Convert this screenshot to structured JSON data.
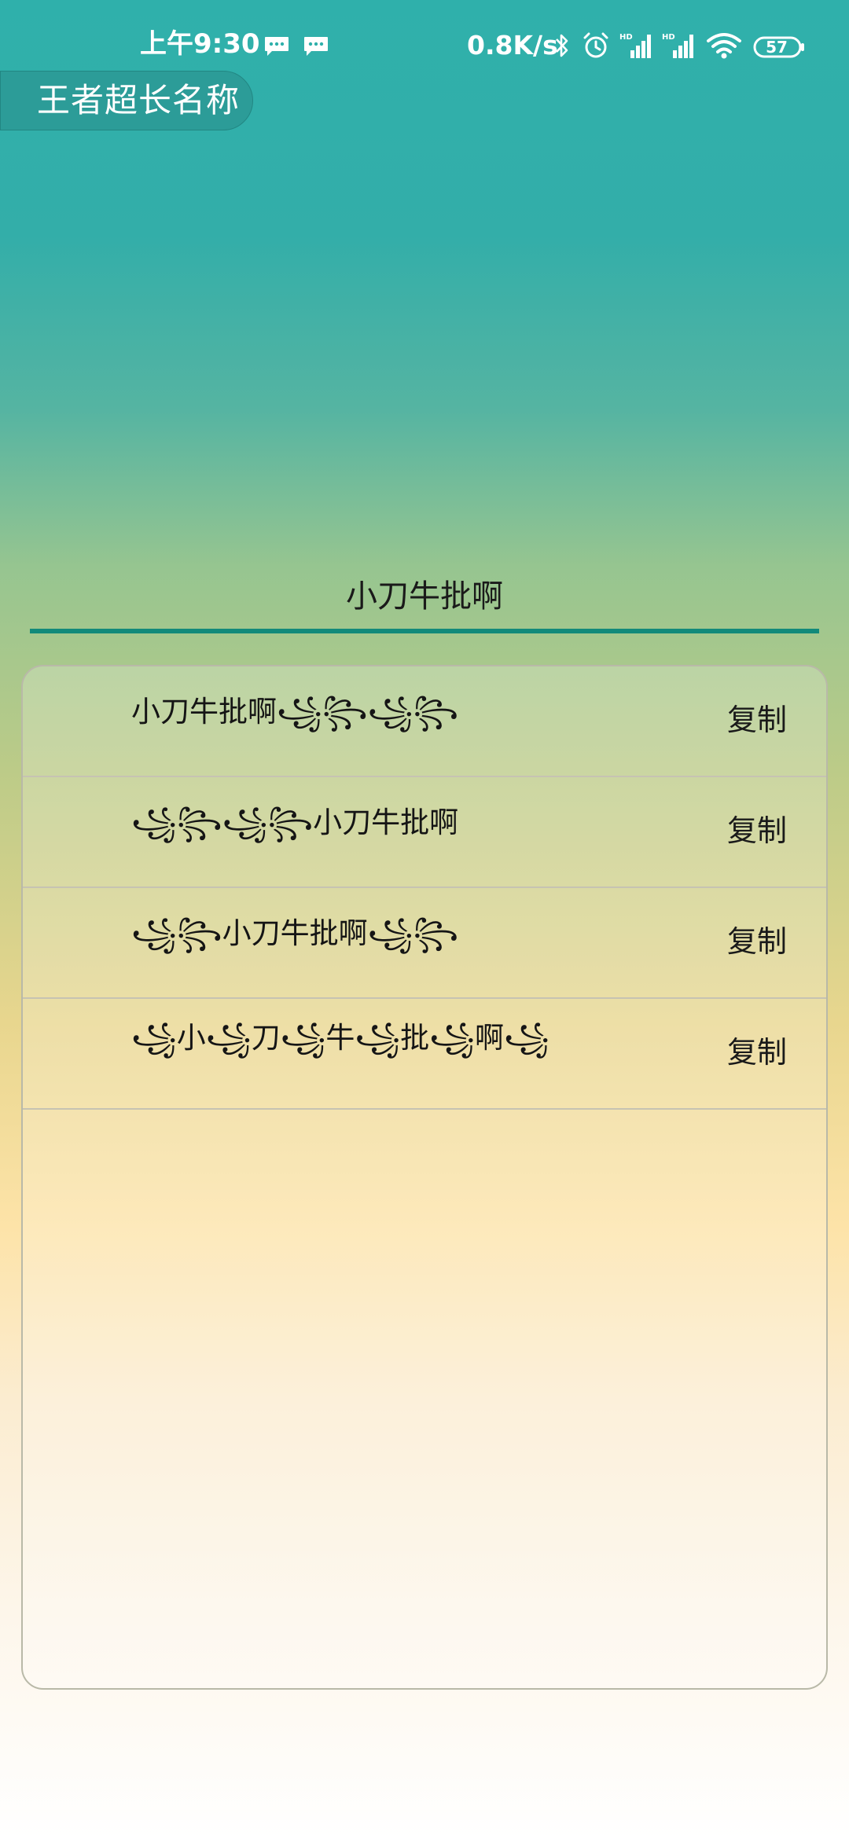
{
  "status_bar": {
    "time": "上午9:30",
    "network_speed": "0.8K/s",
    "battery_level": "57",
    "icons": [
      "message-icon",
      "message-icon",
      "bluetooth-icon",
      "alarm-icon",
      "signal-hd-icon",
      "signal-hd-icon",
      "wifi-icon",
      "battery-icon"
    ]
  },
  "app": {
    "chip_label": "王者超长名称"
  },
  "input": {
    "value": "小刀牛批啊"
  },
  "results": [
    {
      "text": "小刀牛批啊꧁꧂꧁꧂",
      "copy_label": "复制"
    },
    {
      "text": "꧁꧂꧁꧂小刀牛批啊",
      "copy_label": "复制"
    },
    {
      "text": "꧁꧂小刀牛批啊꧁꧂",
      "copy_label": "复制"
    },
    {
      "text": "꧁小꧁刀꧁牛꧁批꧁啊꧁",
      "copy_label": "复制"
    }
  ],
  "colors": {
    "accent_underline": "#128a7a",
    "chip_background": "#2c9c98",
    "top_gradient": "#2fb0ab"
  }
}
